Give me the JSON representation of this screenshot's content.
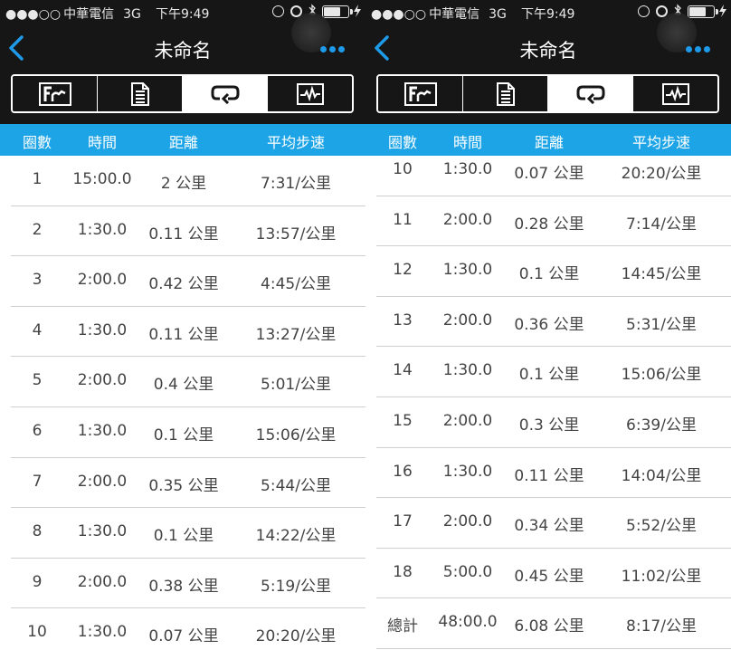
{
  "status_bar": {
    "signal": "●●●○○",
    "carrier": "中華電信",
    "network": "3G",
    "time": "下午9:49",
    "battery_level": 0.7
  },
  "nav": {
    "title": "未命名",
    "more_icon": "more-dots-icon",
    "back_icon": "chevron-left-icon",
    "accent": "#1e9ae8"
  },
  "tabs": [
    {
      "icon": "chart-icon",
      "active": false
    },
    {
      "icon": "document-list-icon",
      "active": false
    },
    {
      "icon": "laps-loop-icon",
      "active": true
    },
    {
      "icon": "waveform-icon",
      "active": false
    }
  ],
  "header": {
    "lap": "圈數",
    "time": "時間",
    "distance": "距離",
    "pace": "平均步速",
    "color": "#1ca4e6"
  },
  "panels": [
    {
      "rows_offset": 0,
      "rows": [
        {
          "lap": "1",
          "time": "15:00.0",
          "distance": "2 公里",
          "pace": "7:31/公里"
        },
        {
          "lap": "2",
          "time": "1:30.0",
          "distance": "0.11 公里",
          "pace": "13:57/公里"
        },
        {
          "lap": "3",
          "time": "2:00.0",
          "distance": "0.42 公里",
          "pace": "4:45/公里"
        },
        {
          "lap": "4",
          "time": "1:30.0",
          "distance": "0.11 公里",
          "pace": "13:27/公里"
        },
        {
          "lap": "5",
          "time": "2:00.0",
          "distance": "0.4 公里",
          "pace": "5:01/公里"
        },
        {
          "lap": "6",
          "time": "1:30.0",
          "distance": "0.1 公里",
          "pace": "15:06/公里"
        },
        {
          "lap": "7",
          "time": "2:00.0",
          "distance": "0.35 公里",
          "pace": "5:44/公里"
        },
        {
          "lap": "8",
          "time": "1:30.0",
          "distance": "0.1 公里",
          "pace": "14:22/公里"
        },
        {
          "lap": "9",
          "time": "2:00.0",
          "distance": "0.38 公里",
          "pace": "5:19/公里"
        },
        {
          "lap": "10",
          "time": "1:30.0",
          "distance": "0.07 公里",
          "pace": "20:20/公里"
        }
      ]
    },
    {
      "rows_offset": 1,
      "rows": [
        {
          "lap": "10",
          "time": "1:30.0",
          "distance": "0.07 公里",
          "pace": "20:20/公里"
        },
        {
          "lap": "11",
          "time": "2:00.0",
          "distance": "0.28 公里",
          "pace": "7:14/公里"
        },
        {
          "lap": "12",
          "time": "1:30.0",
          "distance": "0.1 公里",
          "pace": "14:45/公里"
        },
        {
          "lap": "13",
          "time": "2:00.0",
          "distance": "0.36 公里",
          "pace": "5:31/公里"
        },
        {
          "lap": "14",
          "time": "1:30.0",
          "distance": "0.1 公里",
          "pace": "15:06/公里"
        },
        {
          "lap": "15",
          "time": "2:00.0",
          "distance": "0.3 公里",
          "pace": "6:39/公里"
        },
        {
          "lap": "16",
          "time": "1:30.0",
          "distance": "0.11 公里",
          "pace": "14:04/公里"
        },
        {
          "lap": "17",
          "time": "2:00.0",
          "distance": "0.34 公里",
          "pace": "5:52/公里"
        },
        {
          "lap": "18",
          "time": "5:00.0",
          "distance": "0.45 公里",
          "pace": "11:02/公里"
        },
        {
          "lap": "總計",
          "time": "48:00.0",
          "distance": "6.08 公里",
          "pace": "8:17/公里",
          "total": true
        }
      ]
    }
  ]
}
